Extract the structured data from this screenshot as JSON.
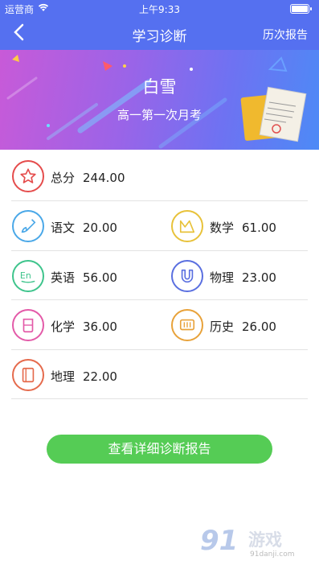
{
  "status_bar": {
    "carrier": "运营商",
    "time": "上午9:33"
  },
  "nav": {
    "back": "‹",
    "title": "学习诊断",
    "history": "历次报告"
  },
  "banner": {
    "student_name": "白雪",
    "exam_name": "高一第一次月考"
  },
  "total": {
    "label": "总分",
    "score": "244.00",
    "icon": "star-icon",
    "color": "#e54c4c"
  },
  "subjects": [
    {
      "label": "语文",
      "score": "20.00",
      "icon": "brush-icon",
      "color": "#4aa8e8"
    },
    {
      "label": "数学",
      "score": "61.00",
      "icon": "math-icon",
      "color": "#e8c23a"
    },
    {
      "label": "英语",
      "score": "56.00",
      "icon": "english-icon",
      "color": "#3ec48c"
    },
    {
      "label": "物理",
      "score": "23.00",
      "icon": "magnet-icon",
      "color": "#5a6fe0"
    },
    {
      "label": "化学",
      "score": "36.00",
      "icon": "beaker-icon",
      "color": "#e35aa8"
    },
    {
      "label": "历史",
      "score": "26.00",
      "icon": "scroll-icon",
      "color": "#e8a23a"
    },
    {
      "label": "地理",
      "score": "22.00",
      "icon": "book-icon",
      "color": "#e56a4c"
    }
  ],
  "detail_button": {
    "label": "查看详细诊断报告",
    "color": "#55cc55"
  },
  "watermark": {
    "logo": "91",
    "text": "游戏",
    "url": "91danji.com"
  }
}
